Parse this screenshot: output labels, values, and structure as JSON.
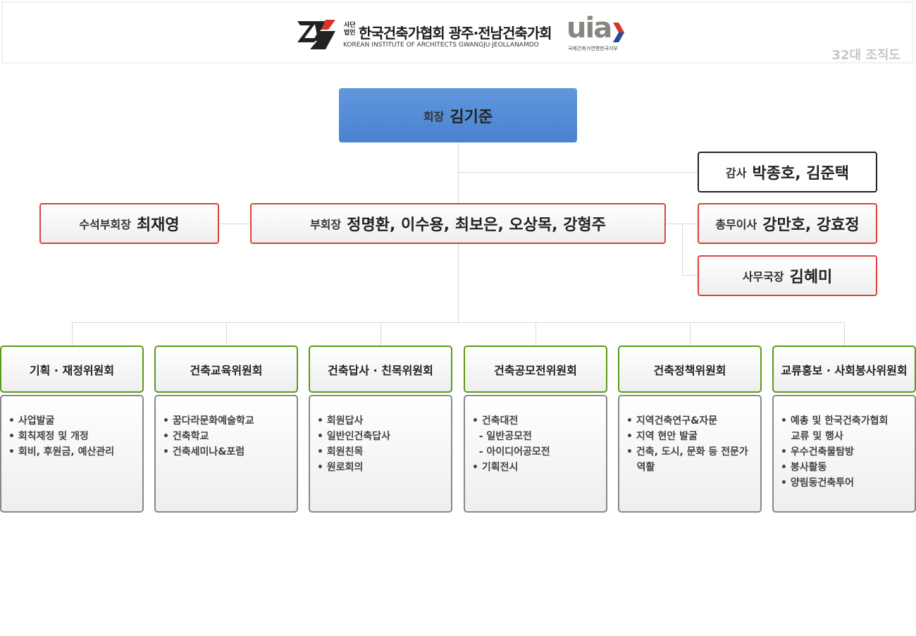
{
  "header": {
    "org_label_line1": "사단",
    "org_label_line2": "법인",
    "org_title": "한국건축가협회 광주·전남건축가회",
    "org_english": "KOREAN INSTITUTE OF ARCHITECTS GWANGJU·JEOLLANAMDO",
    "uia_logo": "uia",
    "uia_sub": "국제건축가연맹한국지부",
    "tag": "32대 조직도"
  },
  "president": {
    "label": "회장",
    "name": "김기준"
  },
  "auditor": {
    "label": "감사",
    "name": "박종호, 김준택"
  },
  "senior_vp": {
    "label": "수석부회장",
    "name": "최재영"
  },
  "vp": {
    "label": "부회장",
    "name": "정명환, 이수용, 최보은, 오상목, 강형주"
  },
  "general_affairs": {
    "label": "총무이사",
    "name": "강만호, 강효정"
  },
  "secretary_general": {
    "label": "사무국장",
    "name": "김혜미"
  },
  "committees": [
    {
      "title": "기획 · 재정위원회",
      "items": [
        "• 사업발굴",
        "• 회칙제정 및 개정",
        "• 회비, 후원금, 예산관리"
      ]
    },
    {
      "title": "건축교육위원회",
      "items": [
        "• 꿈다라문화예술학교",
        "• 건축학교",
        "• 건축세미나&포럼"
      ]
    },
    {
      "title": "건축답사 · 친목위원회",
      "items": [
        "• 회원답사",
        "• 일반인건축답사",
        "• 회원친목",
        "• 원로회의"
      ]
    },
    {
      "title": "건축공모전위원회",
      "items": [
        "• 건축대전",
        "  - 일반공모전",
        "  - 아이디어공모전",
        "• 기획전시"
      ]
    },
    {
      "title": "건축정책위원회",
      "items": [
        "• 지역건축연구&자문",
        "• 지역 현안 발굴",
        "• 건축, 도시, 문화 등 전문가",
        "   역활"
      ]
    },
    {
      "title": "교류홍보 · 사회봉사위원회",
      "items": [
        "• 예총 및 한국건축가협회",
        "   교류 및 행사",
        "• 우수건축물탐방",
        "• 봉사활동",
        "• 양림동건축투어"
      ]
    }
  ],
  "colors": {
    "president_blue": "#5a90da",
    "officer_border": "#d9443a",
    "committee_border": "#5a9a1a",
    "logo_red": "#d9342b",
    "uia_blue": "#1f4e9c"
  }
}
